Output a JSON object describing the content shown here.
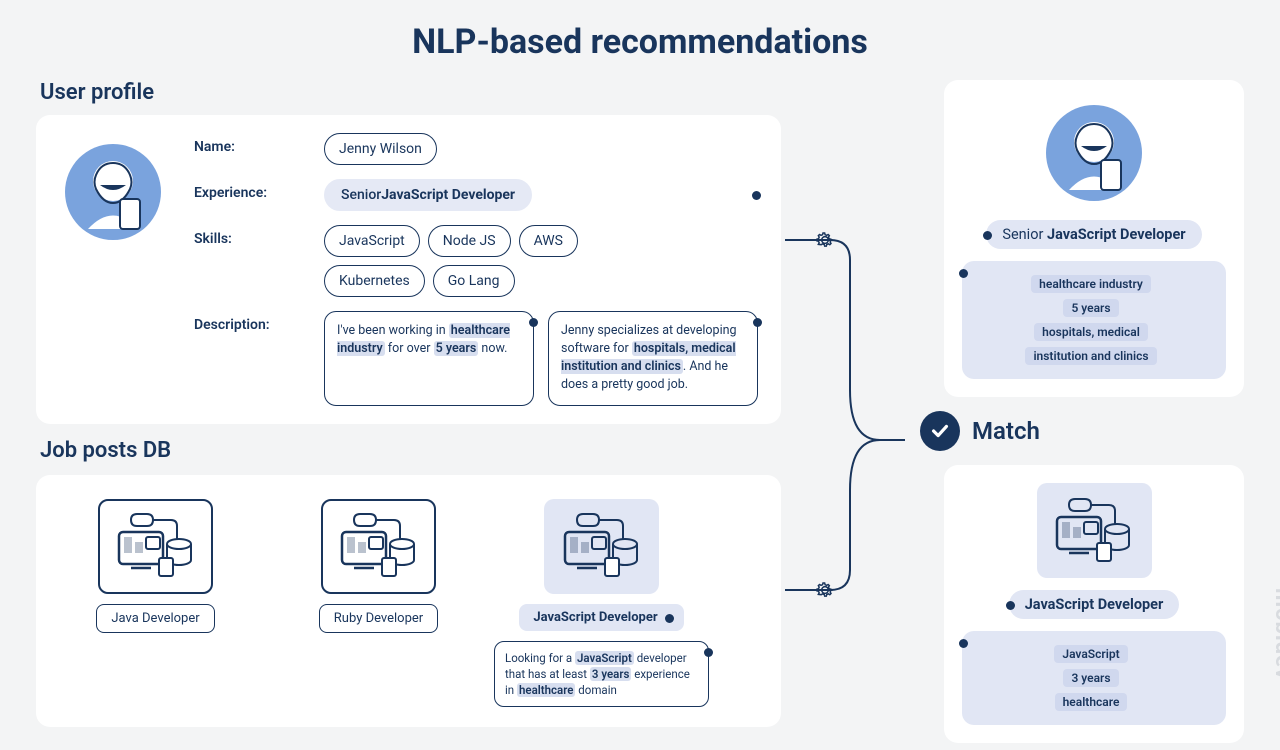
{
  "title": "NLP-based recommendations",
  "sections": {
    "user_profile": "User profile",
    "job_posts": "Job posts DB"
  },
  "profile": {
    "labels": {
      "name": "Name:",
      "experience": "Experience:",
      "skills": "Skills:",
      "description": "Description:"
    },
    "name": "Jenny Wilson",
    "experience_prefix": "Senior ",
    "experience_bold": "JavaScript Developer",
    "skills": [
      "JavaScript",
      "Node JS",
      "AWS",
      "Kubernetes",
      "Go Lang"
    ],
    "desc1": {
      "pre": "I've been working in ",
      "hl1": "healthcare industry",
      "mid": " for over ",
      "hl2": "5 years",
      "post": " now."
    },
    "desc2": {
      "pre": "Jenny specializes at developing software for ",
      "hl1": "hospitals, medical institution and clinics",
      "post": ". And he does a pretty good job."
    }
  },
  "jobs": [
    {
      "label": "Java Developer",
      "active": false
    },
    {
      "label": "Ruby Developer",
      "active": false
    },
    {
      "label": "JavaScript Developer",
      "active": true
    }
  ],
  "job_desc": {
    "pre": "Looking for a ",
    "hl1": "JavaScript",
    "mid1": " developer that has at least ",
    "hl2": "3 years",
    "mid2": " experience in ",
    "hl3": "healthcare",
    "post": " domain"
  },
  "extract_top": {
    "title_prefix": "Senior ",
    "title_bold": "JavaScript Developer",
    "tags": [
      "healthcare industry",
      "5 years",
      "hospitals, medical",
      "institution and clinics"
    ]
  },
  "match_label": "Match",
  "extract_bottom": {
    "title_bold": "JavaScript Developer",
    "tags": [
      "JavaScript",
      "3 years",
      "healthcare"
    ]
  },
  "brand": "mobidev"
}
